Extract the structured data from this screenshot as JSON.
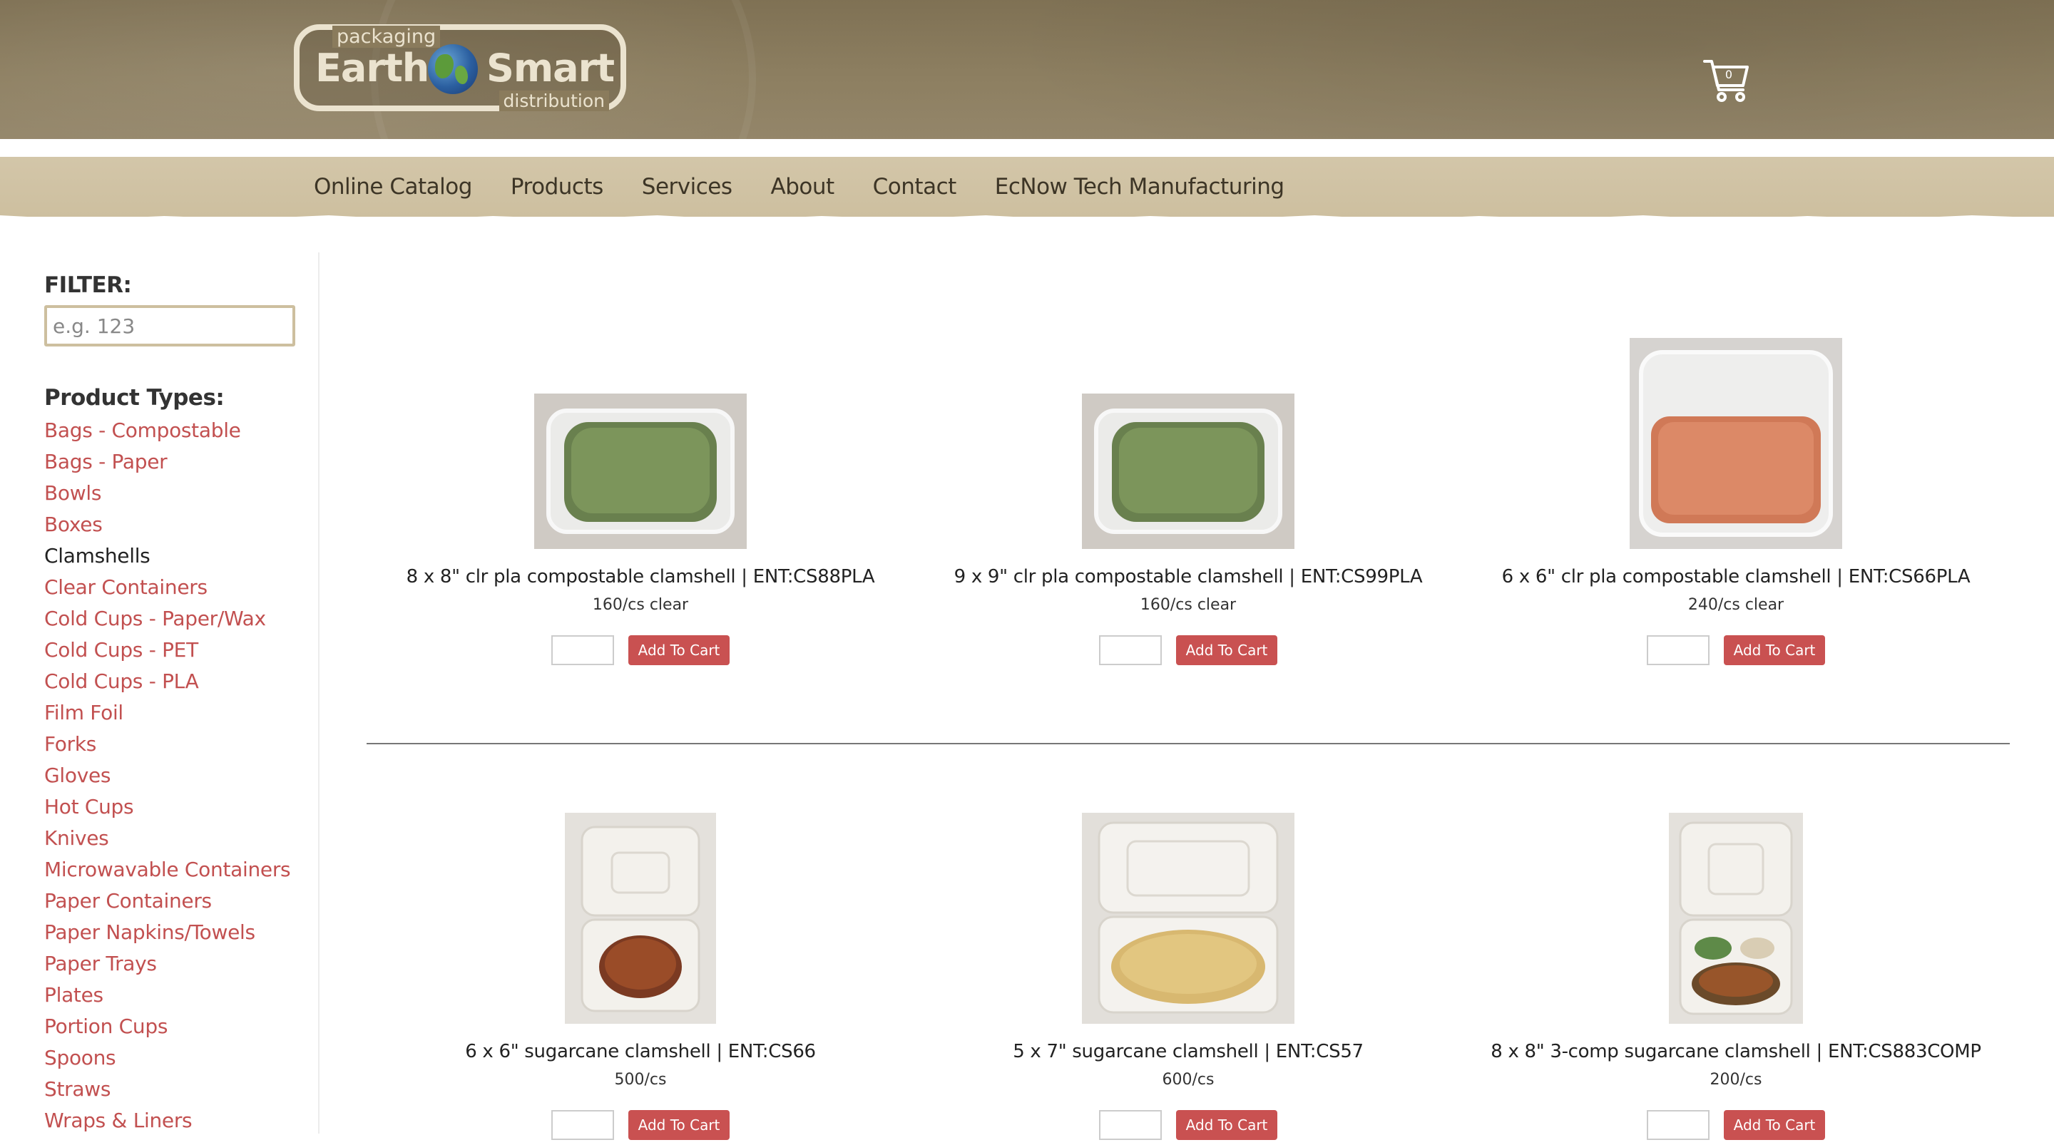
{
  "header": {
    "logo": {
      "top_text": "packaging",
      "left_word": "Earth",
      "right_word": "Smart",
      "bottom_text": "distribution"
    },
    "cart_count": "0"
  },
  "nav": {
    "items": [
      "Online Catalog",
      "Products",
      "Services",
      "About",
      "Contact",
      "EcNow Tech Manufacturing"
    ]
  },
  "sidebar": {
    "filter_label": "FILTER:",
    "filter_placeholder": "e.g. 123",
    "types_label": "Product Types:",
    "active_type": "Clamshells",
    "types": [
      "Bags - Compostable",
      "Bags - Paper",
      "Bowls",
      "Boxes",
      "Clamshells",
      "Clear Containers",
      "Cold Cups - Paper/Wax",
      "Cold Cups - PET",
      "Cold Cups - PLA",
      "Film Foil",
      "Forks",
      "Gloves",
      "Hot Cups",
      "Knives",
      "Microwavable Containers",
      "Paper Containers",
      "Paper Napkins/Towels",
      "Paper Trays",
      "Plates",
      "Portion Cups",
      "Spoons",
      "Straws",
      "Wraps & Liners"
    ]
  },
  "products": [
    {
      "name": "8 x 8\" clr pla compostable clamshell | ENT:CS88PLA",
      "pack": "160/cs clear",
      "button": "Add To Cart",
      "image": "clear-clamshell-green-peas"
    },
    {
      "name": "9 x 9\" clr pla compostable clamshell | ENT:CS99PLA",
      "pack": "160/cs clear",
      "button": "Add To Cart",
      "image": "clear-clamshell-green-peas"
    },
    {
      "name": "6 x 6\" clr pla compostable clamshell | ENT:CS66PLA",
      "pack": "240/cs clear",
      "button": "Add To Cart",
      "image": "clear-clamshell-red-lentils"
    },
    {
      "name": "6 x 6\" sugarcane clamshell | ENT:CS66",
      "pack": "500/cs",
      "button": "Add To Cart",
      "image": "sugarcane-clamshell-rice"
    },
    {
      "name": "5 x 7\" sugarcane clamshell | ENT:CS57",
      "pack": "600/cs",
      "button": "Add To Cart",
      "image": "sugarcane-clamshell-pasta"
    },
    {
      "name": "8 x 8\" 3-comp sugarcane clamshell | ENT:CS883COMP",
      "pack": "200/cs",
      "button": "Add To Cart",
      "image": "sugarcane-3comp-clamshell"
    }
  ]
}
